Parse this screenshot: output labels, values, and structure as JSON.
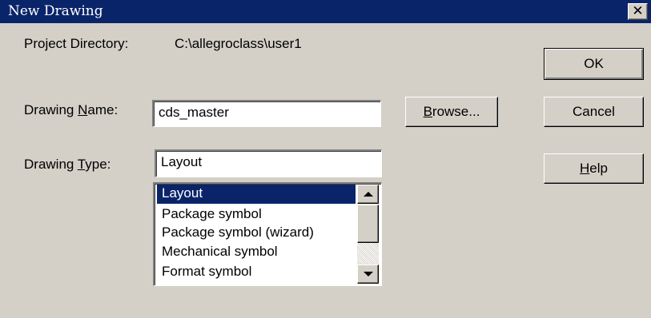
{
  "window": {
    "title": "New Drawing",
    "close_glyph": "✕"
  },
  "project": {
    "label": "Project Directory:",
    "value": "C:\\allegroclass\\user1"
  },
  "drawing_name": {
    "label_prefix": "Drawing ",
    "label_mnemonic": "N",
    "label_suffix": "ame:",
    "value": "cds_master"
  },
  "drawing_type": {
    "label_prefix": "Drawing ",
    "label_mnemonic": "T",
    "label_suffix": "ype:",
    "value": "Layout",
    "options": [
      "Layout",
      "Package symbol",
      "Package symbol (wizard)",
      "Mechanical symbol",
      "Format symbol"
    ],
    "selected_index": 0
  },
  "buttons": {
    "browse_mnemonic": "B",
    "browse_suffix": "rowse...",
    "ok": "OK",
    "cancel": "Cancel",
    "help_mnemonic": "H",
    "help_suffix": "elp"
  },
  "colors": {
    "titlebar": "#0a246a",
    "face": "#d4d0c8",
    "selection": "#0a246a"
  },
  "icons": {
    "close": "close-icon",
    "scroll_up": "arrow-up-icon",
    "scroll_down": "arrow-down-icon"
  }
}
